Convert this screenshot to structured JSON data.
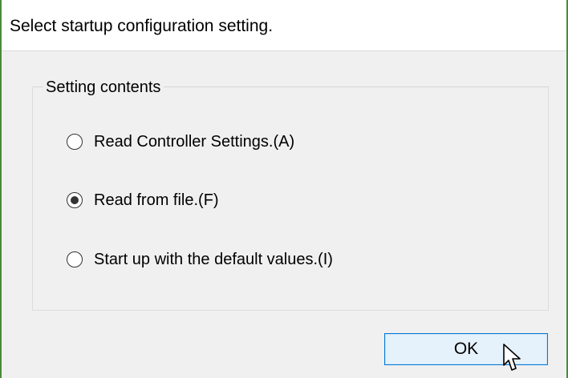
{
  "dialog": {
    "instruction": "Select startup configuration setting.",
    "group_title": "Setting contents",
    "options": [
      {
        "label": "Read Controller Settings.(A)",
        "selected": false
      },
      {
        "label": "Read from file.(F)",
        "selected": true
      },
      {
        "label": "Start up with the default values.(I)",
        "selected": false
      }
    ],
    "ok_label": "OK"
  },
  "icons": {
    "cursor": "pointer-arrow-icon"
  },
  "colors": {
    "window_border": "#4a8a3c",
    "button_border": "#0078d7",
    "button_fill": "#e5f1fb",
    "dialog_body": "#f0f0f0"
  }
}
